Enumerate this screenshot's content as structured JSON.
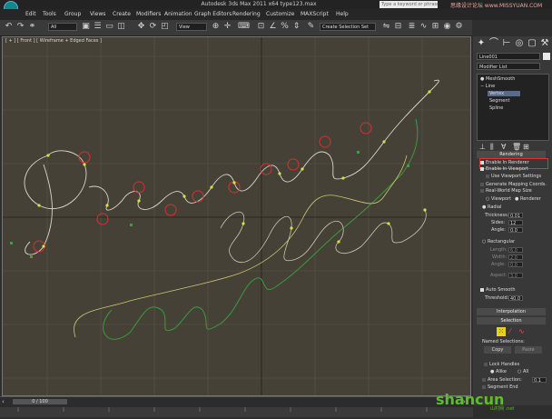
{
  "window": {
    "title": "Autodesk 3ds Max 2011 x64     type123.max",
    "search_placeholder": "Type a keyword or phrase",
    "watermark_top": "思缘设计论坛 www.MISSYUAN.COM"
  },
  "menu": {
    "items": [
      "Edit",
      "Tools",
      "Group",
      "Views",
      "Create",
      "Modifiers",
      "Animation",
      "Graph Editors",
      "Rendering",
      "Customize",
      "MAXScript",
      "Help"
    ]
  },
  "toolbar": {
    "selection_filter": "All",
    "reference_coord": "View",
    "named_selection": "Create Selection Set"
  },
  "viewport": {
    "label": "[ + ] [ Front ] [ Wireframe + Edged Faces ]",
    "background": "#464137"
  },
  "command_panel": {
    "object_name": "Line001",
    "object_color": "#e8e8e8",
    "modifier_list": "Modifier List",
    "stack": [
      {
        "label": "MeshSmooth",
        "selected": false
      },
      {
        "label": "Line",
        "selected": false
      },
      {
        "label": "Vertex",
        "selected": true
      },
      {
        "label": "Segment",
        "selected": false
      },
      {
        "label": "Spline",
        "selected": false
      }
    ],
    "rendering": {
      "header": "Rendering",
      "enable_in_renderer": "Enable In Renderer",
      "enable_in_viewport": "Enable In Viewport",
      "use_viewport_settings": "Use Viewport Settings",
      "generate_mapping": "Generate Mapping Coords.",
      "real_world_map": "Real-World Map Size",
      "viewport_radio": "Viewport",
      "renderer_radio": "Renderer",
      "radial": "Radial",
      "thickness_label": "Thickness:",
      "thickness_value": "0.01",
      "sides_label": "Sides:",
      "sides_value": "12",
      "angle_label": "Angle:",
      "angle_value": "0.0",
      "rectangular": "Rectangular",
      "length_label": "Length:",
      "length_value": "6.0",
      "width_label": "Width:",
      "width_value": "2.0",
      "angle2_label": "Angle:",
      "angle2_value": "0.0",
      "aspect_label": "Aspect:",
      "aspect_value": "3.0",
      "auto_smooth": "Auto Smooth",
      "threshold_label": "Threshold:",
      "threshold_value": "40.0"
    },
    "interpolation": "Interpolation",
    "selection": {
      "header": "Selection",
      "named_selections": "Named Selections:",
      "copy": "Copy",
      "paste": "Paste",
      "lock_handles": "Lock Handles",
      "alike": "Alike",
      "all": "All",
      "area_selection": "Area Selection:",
      "area_value": "0.1",
      "segment_end": "Segment End"
    }
  },
  "timeline": {
    "slider": "0 / 100"
  },
  "watermark": {
    "brand": "shancun",
    "sub": "山村网 .net"
  }
}
